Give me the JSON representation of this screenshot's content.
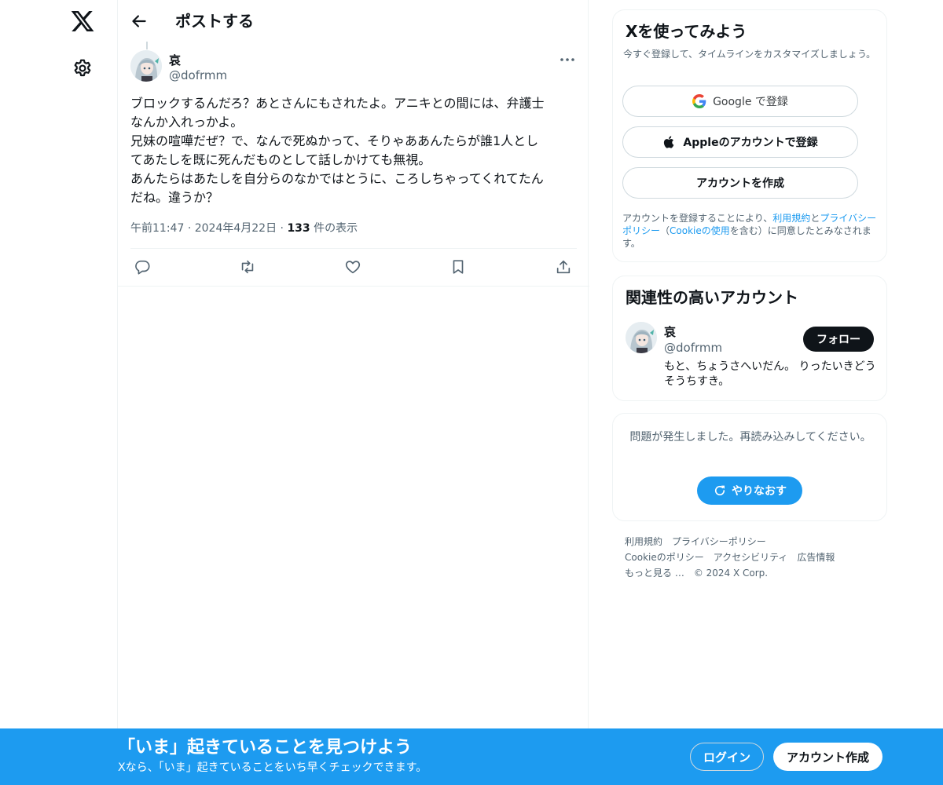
{
  "nav": {
    "logo_icon": "x-logo-icon",
    "settings_icon": "gear-icon"
  },
  "header": {
    "back_icon": "arrow-left-icon",
    "title": "ポストする"
  },
  "post": {
    "author_name": "哀",
    "author_handle": "@dofrmm",
    "more_icon": "more-dots-icon",
    "lines": [
      "ブロックするんだろ？あとさんにもされたよ。アニキとの間には、弁護士",
      "なんか入れっかよ。",
      "兄妹の喧嘩だぜ？で、なんで死ぬかって、そりゃああんたらが誰1人とし",
      "てあたしを既に死んだものとして話しかけても無視。",
      "あんたらはあたしを自分らのなかではとうに、ころしちゃってくれてたん",
      "だね。違うか？"
    ],
    "time": "午前11:47",
    "separator": "·",
    "date": "2024年4月22日",
    "views_count": "133",
    "views_label": "件の表示",
    "actions": {
      "reply_icon": "reply-icon",
      "repost_icon": "repost-icon",
      "like_icon": "heart-icon",
      "bookmark_icon": "bookmark-icon",
      "share_icon": "share-icon"
    }
  },
  "signup": {
    "title": "Xを使ってみよう",
    "subtitle": "今すぐ登録して、タイムラインをカスタマイズしましょう。",
    "google_label": "Google で登録",
    "apple_label": "Appleのアカウントで登録",
    "create_label": "アカウントを作成",
    "legal_prefix": "アカウントを登録することにより、",
    "terms": "利用規約",
    "and": "と",
    "privacy": "プライバシーポリシー",
    "paren_open": "（",
    "cookie": "Cookieの使用",
    "legal_suffix": "を含む）に同意したとみなされます。"
  },
  "related": {
    "title": "関連性の高いアカウント",
    "name": "哀",
    "handle": "@dofrmm",
    "follow_label": "フォロー",
    "bio": "もと、ちょうさへいだん。 りったいきどうそうちすき。"
  },
  "error": {
    "message": "問題が発生しました。再読み込みしてください。",
    "retry_label": "やりなおす"
  },
  "footer": {
    "links": [
      "利用規約",
      "プライバシーポリシー",
      "Cookieのポリシー",
      "アクセシビリティ",
      "広告情報",
      "もっと見る …",
      "© 2024 X Corp."
    ]
  },
  "bottom_bar": {
    "title": "「いま」起きていることを見つけよう",
    "subtitle": "Xなら、「いま」起きていることをいち早くチェックできます。",
    "login_label": "ログイン",
    "create_label": "アカウント作成"
  },
  "colors": {
    "accent": "#1d9bf0",
    "text": "#0f1419",
    "secondary": "#536471"
  }
}
